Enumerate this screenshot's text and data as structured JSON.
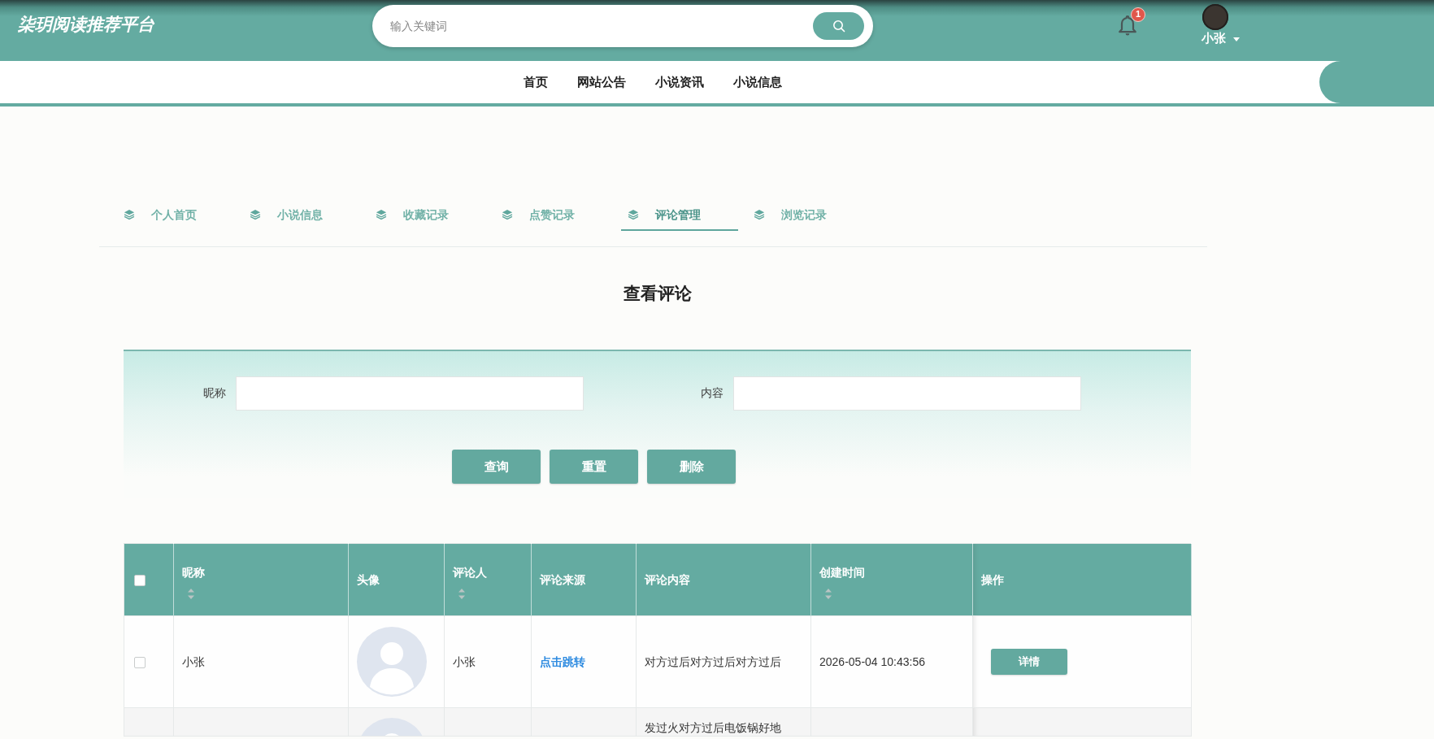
{
  "header": {
    "logo": "柒玥阅读推荐平台",
    "search": {
      "placeholder": "输入关键词"
    },
    "notifications": {
      "badge": "1"
    },
    "user": {
      "name": "小张"
    }
  },
  "nav": [
    {
      "label": "首页"
    },
    {
      "label": "网站公告"
    },
    {
      "label": "小说资讯"
    },
    {
      "label": "小说信息"
    }
  ],
  "tabs": [
    {
      "label": "个人首页",
      "selected": false
    },
    {
      "label": "小说信息",
      "selected": false
    },
    {
      "label": "收藏记录",
      "selected": false
    },
    {
      "label": "点赞记录",
      "selected": false
    },
    {
      "label": "评论管理",
      "selected": true
    },
    {
      "label": "浏览记录",
      "selected": false
    }
  ],
  "page_title": "查看评论",
  "filters": [
    {
      "label": "昵称"
    },
    {
      "label": "内容"
    }
  ],
  "buttons": [
    {
      "label": "查询"
    },
    {
      "label": "重置"
    },
    {
      "label": "删除"
    }
  ],
  "table": {
    "columns": [
      {
        "kind": "checkbox",
        "checked": false
      },
      {
        "kind": "text",
        "label": "昵称",
        "sortable": true
      },
      {
        "kind": "text",
        "label": "头像",
        "sortable": false
      },
      {
        "kind": "text",
        "label": "评论人",
        "sortable": true
      },
      {
        "kind": "text",
        "label": "评论来源",
        "sortable": false
      },
      {
        "kind": "text",
        "label": "评论内容",
        "sortable": false
      },
      {
        "kind": "text",
        "label": "创建时间",
        "sortable": true
      },
      {
        "kind": "text",
        "label": "操作",
        "sortable": false
      }
    ],
    "rows": [
      {
        "checked": false,
        "nickname": "小张",
        "commenter": "小张",
        "source": "点击跳转",
        "content": "对方过后对方过后对方过后",
        "created": "2026-05-04 10:43:56",
        "action": "详情"
      },
      {
        "content": "发过火对方过后电饭锅好地"
      }
    ]
  }
}
